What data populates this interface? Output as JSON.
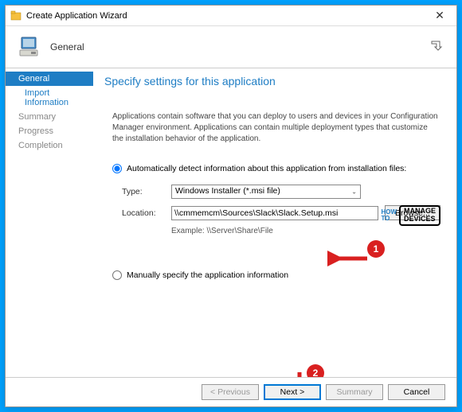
{
  "window": {
    "title": "Create Application Wizard"
  },
  "banner": {
    "label": "General"
  },
  "sidebar": {
    "items": [
      {
        "label": "General"
      },
      {
        "label": "Import Information"
      },
      {
        "label": "Summary"
      },
      {
        "label": "Progress"
      },
      {
        "label": "Completion"
      }
    ]
  },
  "main": {
    "title": "Specify settings for this application",
    "description": "Applications contain software that you can deploy to users and devices in your Configuration Manager environment. Applications can contain multiple deployment types that customize the installation behavior of the application.",
    "radio_auto_label": "Automatically detect information about this application from installation files:",
    "radio_manual_label": "Manually specify the application information",
    "fields": {
      "type_label": "Type:",
      "type_value": "Windows Installer (*.msi file)",
      "location_label": "Location:",
      "location_value": "\\\\cmmemcm\\Sources\\Slack\\Slack.Setup.msi",
      "example_label": "Example: \\\\Server\\Share\\File",
      "browse_label": "Browse..."
    }
  },
  "footer": {
    "previous": "< Previous",
    "next": "Next >",
    "summary": "Summary",
    "cancel": "Cancel"
  },
  "watermark": {
    "howto": "HOW TO",
    "manage": "MANAGE",
    "devices": "DEVICES"
  },
  "callouts": {
    "one": "1",
    "two": "2"
  }
}
